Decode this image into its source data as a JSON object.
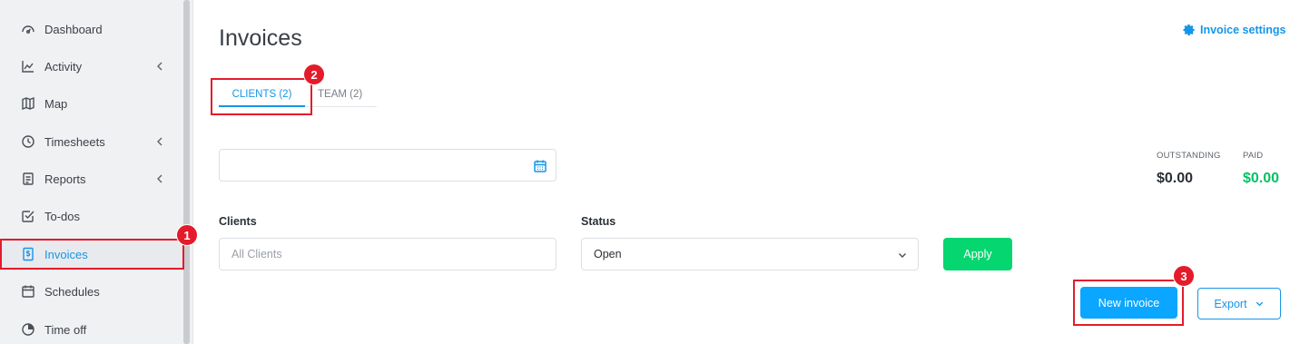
{
  "sidebar": {
    "items": [
      {
        "label": "Dashboard",
        "icon": "dashboard-icon"
      },
      {
        "label": "Activity",
        "icon": "activity-icon",
        "expandable": true
      },
      {
        "label": "Map",
        "icon": "map-icon"
      },
      {
        "label": "Timesheets",
        "icon": "clock-icon",
        "expandable": true
      },
      {
        "label": "Reports",
        "icon": "report-icon",
        "expandable": true
      },
      {
        "label": "To-dos",
        "icon": "checkbox-icon"
      },
      {
        "label": "Invoices",
        "icon": "invoice-icon",
        "active": true
      },
      {
        "label": "Schedules",
        "icon": "calendar-icon"
      },
      {
        "label": "Time off",
        "icon": "pie-icon"
      }
    ]
  },
  "page": {
    "title": "Invoices",
    "settings_link": "Invoice settings"
  },
  "tabs": [
    {
      "label": "CLIENTS (2)",
      "active": true
    },
    {
      "label": "TEAM (2)",
      "active": false
    }
  ],
  "date_range": {
    "value": "",
    "icon": "calendar-icon"
  },
  "stats": {
    "outstanding_label": "OUTSTANDING",
    "outstanding_value": "$0.00",
    "paid_label": "PAID",
    "paid_value": "$0.00"
  },
  "filters": {
    "clients_label": "Clients",
    "clients_placeholder": "All Clients",
    "status_label": "Status",
    "status_value": "Open",
    "apply_label": "Apply"
  },
  "actions": {
    "new_invoice_label": "New invoice",
    "export_label": "Export"
  },
  "callouts": [
    "1",
    "2",
    "3"
  ],
  "colors": {
    "accent": "#1596e8",
    "paid_green": "#06c167",
    "apply_green": "#06d66f",
    "primary_button": "#0aa6ff",
    "callout_red": "#e31b2b"
  }
}
